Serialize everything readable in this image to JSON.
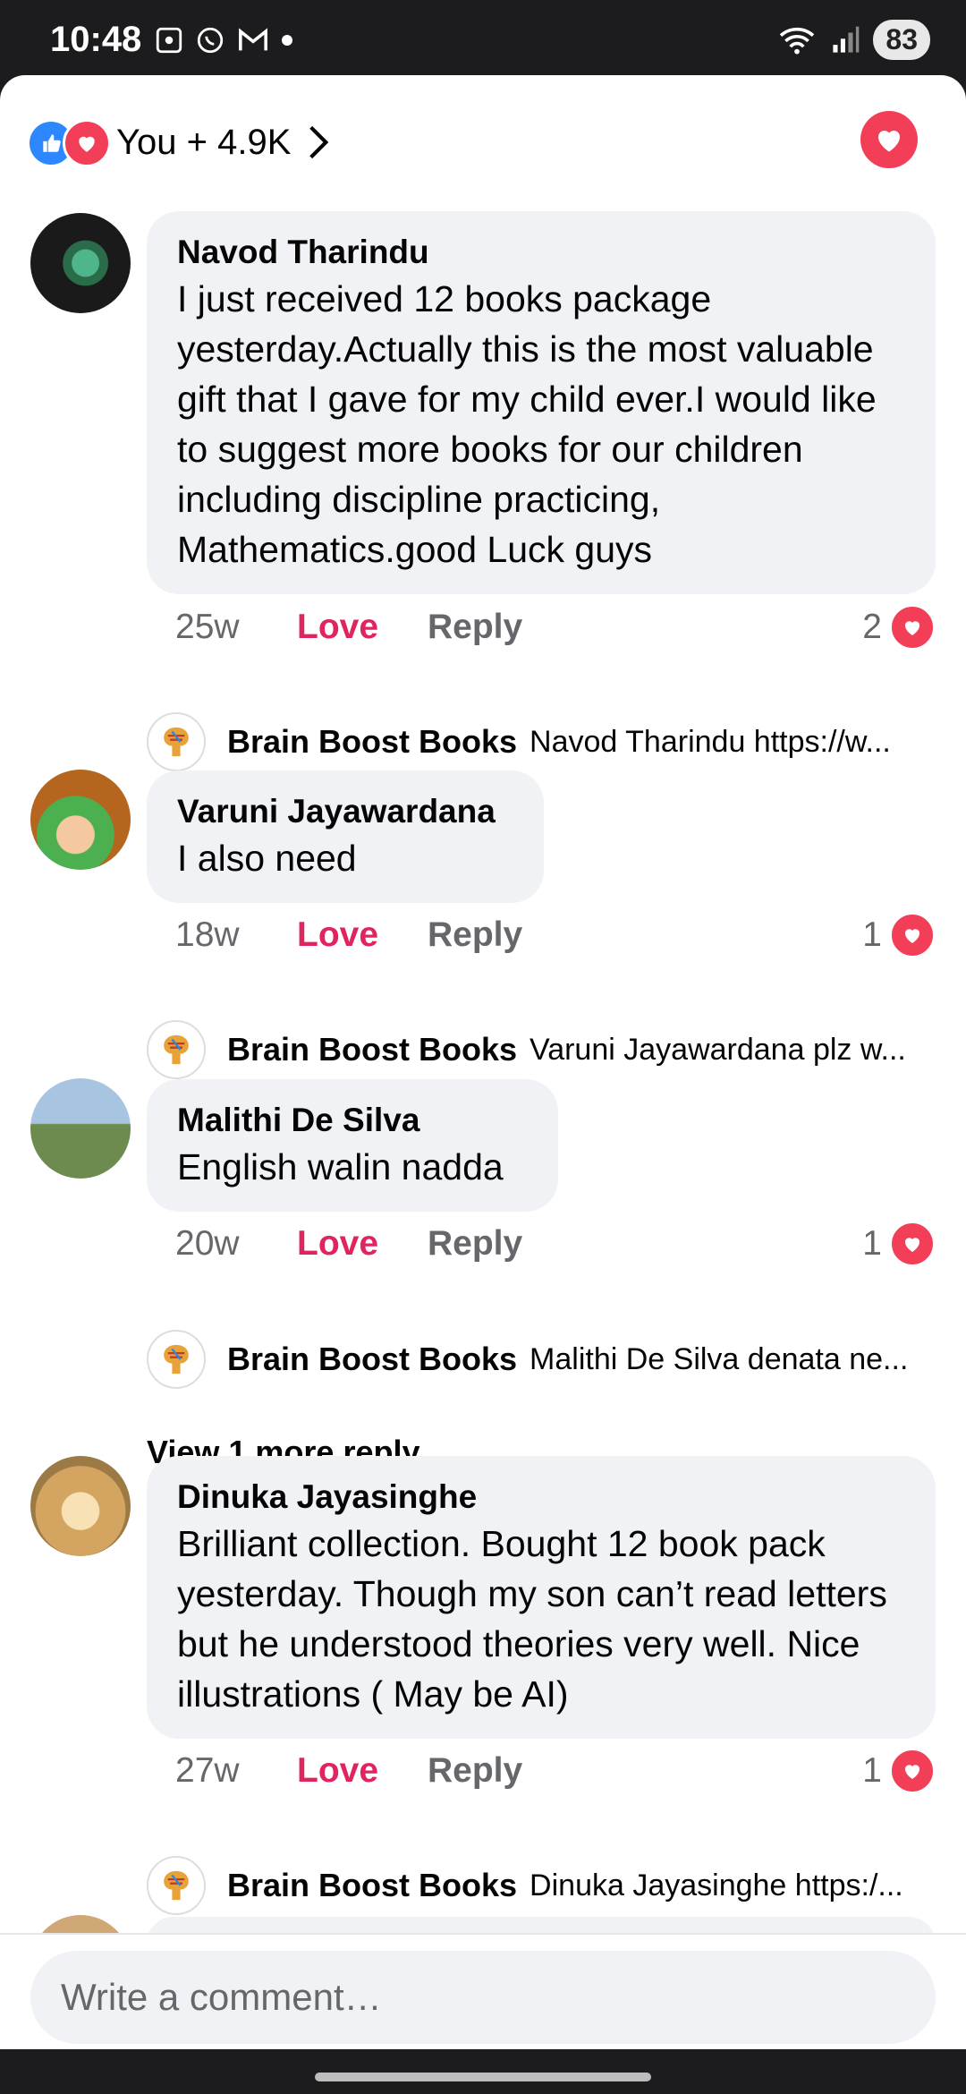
{
  "status_bar": {
    "time": "10:48",
    "battery": "83"
  },
  "reactions": {
    "summary": "You + 4.9K"
  },
  "comments": [
    {
      "author": "Navod Tharindu",
      "text": "I just received 12 books package yesterday.Actually this is the most valuable gift that I gave for my child ever.I would like to suggest more books for our children including discipline practicing, Mathematics.good Luck guys",
      "time": "25w",
      "love_label": "Love",
      "reply_label": "Reply",
      "reaction_count": "2",
      "reply": {
        "author": "Brain Boost Books",
        "snippet": "Navod Tharindu https://w..."
      }
    },
    {
      "author": "Varuni Jayawardana",
      "text": "I also need",
      "time": "18w",
      "love_label": "Love",
      "reply_label": "Reply",
      "reaction_count": "1",
      "reply": {
        "author": "Brain Boost Books",
        "snippet": "Varuni Jayawardana plz w..."
      }
    },
    {
      "author": "Malithi De Silva",
      "text": "English walin nadda",
      "time": "20w",
      "love_label": "Love",
      "reply_label": "Reply",
      "reaction_count": "1",
      "reply": {
        "author": "Brain Boost Books",
        "snippet": "Malithi De Silva denata ne..."
      },
      "view_more": "View 1 more reply..."
    },
    {
      "author": "Dinuka Jayasinghe",
      "text": "Brilliant collection. Bought 12 book pack yesterday. Though my son can’t read letters but he understood theories very well. Nice illustrations ( May be AI)",
      "time": "27w",
      "love_label": "Love",
      "reply_label": "Reply",
      "reaction_count": "1",
      "reply": {
        "author": "Brain Boost Books",
        "snippet": "Dinuka Jayasinghe https:/..."
      }
    }
  ],
  "composer": {
    "placeholder": "Write a comment…"
  },
  "colors": {
    "love": "#f33e58",
    "like": "#2d88ff",
    "bubble": "#f0f2f5",
    "love_text": "#e0245e"
  }
}
